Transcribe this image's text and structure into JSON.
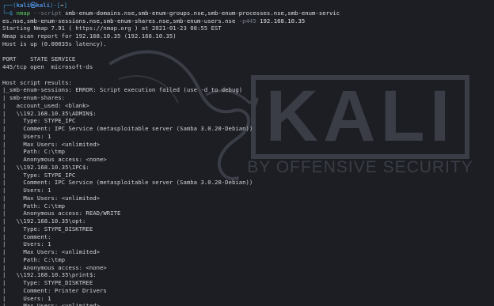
{
  "prompt": {
    "open": "┌──(",
    "user_host": "kali㉿kali",
    "close": ")-[",
    "path": "~",
    "end": "]",
    "arrow": "└─$ "
  },
  "command": {
    "name": "nmap",
    "flag_script": "--script",
    "scripts_part1": "smb-enum-domains.nse,smb-enum-groups.nse,smb-enum-processes.nse,smb-enum-servic",
    "scripts_part2": "es.nse,smb-enum-sessions.nse,smb-enum-shares.nse,smb-enum-users.nse",
    "flag_port": "-p445",
    "target": "192.168.10.35"
  },
  "output_lines": [
    "Starting Nmap 7.91 ( https://nmap.org ) at 2021-01-23 08:55 EST",
    "Nmap scan report for 192.168.10.35 (192.168.10.35)",
    "Host is up (0.00035s latency).",
    "",
    "PORT    STATE SERVICE",
    "445/tcp open  microsoft-ds",
    "",
    "Host script results:",
    "|_smb-enum-sessions: ERROR: Script execution failed (use -d to debug)",
    "| smb-enum-shares:",
    "|   account_used: <blank>",
    "|   \\\\192.168.10.35\\ADMIN$:",
    "|     Type: STYPE_IPC",
    "|     Comment: IPC Service (metasploitable server (Samba 3.0.20-Debian))",
    "|     Users: 1",
    "|     Max Users: <unlimited>",
    "|     Path: C:\\tmp",
    "|     Anonymous access: <none>",
    "|   \\\\192.168.10.35\\IPC$:",
    "|     Type: STYPE_IPC",
    "|     Comment: IPC Service (metasploitable server (Samba 3.0.20-Debian))",
    "|     Users: 1",
    "|     Max Users: <unlimited>",
    "|     Path: C:\\tmp",
    "|     Anonymous access: READ/WRITE",
    "|   \\\\192.168.10.35\\opt:",
    "|     Type: STYPE_DISKTREE",
    "|     Comment:",
    "|     Users: 1",
    "|     Max Users: <unlimited>",
    "|     Path: C:\\tmp",
    "|     Anonymous access: <none>",
    "|   \\\\192.168.10.35\\print$:",
    "|     Type: STYPE_DISKTREE",
    "|     Comment: Printer Drivers",
    "|     Users: 1",
    "|     Max Users: <unlimited>"
  ],
  "watermark": {
    "logo_text": "KALI",
    "tagline": "BY OFFENSIVE SECURITY"
  },
  "colors": {
    "background": "#1c1e24",
    "prompt_blue": "#4f8fdc",
    "command_green": "#5fd35f",
    "flag_gray": "#7a7f8a",
    "text": "#cfd1d5",
    "watermark": "#3a3d45"
  }
}
